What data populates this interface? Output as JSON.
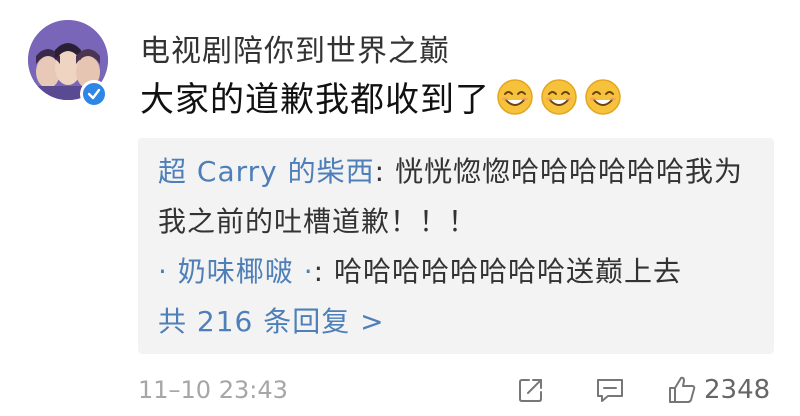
{
  "user": {
    "name": "电视剧陪你到世界之巅",
    "verified": true
  },
  "comment": {
    "text": "大家的道歉我都收到了",
    "emojis": [
      "smile-emoji",
      "smile-emoji",
      "smile-emoji"
    ]
  },
  "replies": {
    "first_author": "超 Carry 的柴西",
    "first_text_line1": ": 恍恍惚惚哈哈哈哈哈哈我为",
    "first_text_line2": "我之前的吐槽道歉！！！",
    "second_author": "· 奶味椰啵 ·",
    "second_text": ": 哈哈哈哈哈哈哈哈送巅上去",
    "more_label": "共 216 条回复 >"
  },
  "footer": {
    "timestamp": "11–10 23:43",
    "like_count": "2348"
  },
  "colors": {
    "link_blue": "#4e7fb8",
    "verified_blue": "#2e86e6",
    "emoji_yellow": "#f7c23b"
  }
}
